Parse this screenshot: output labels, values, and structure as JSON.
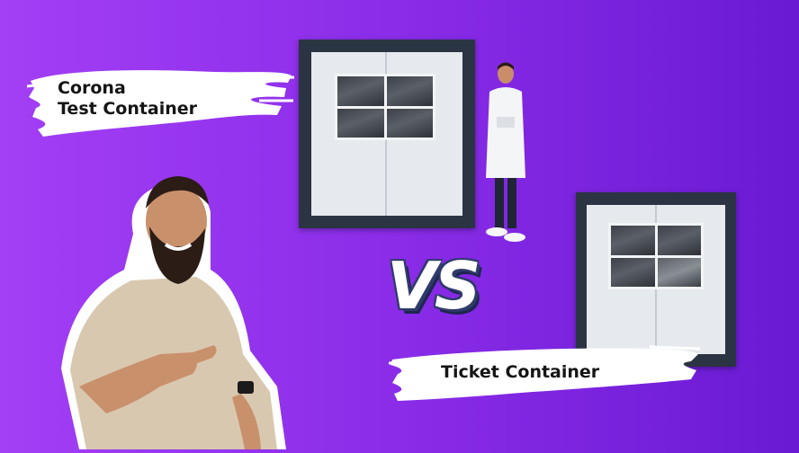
{
  "labels": {
    "left_line1": "Corona",
    "left_line2": "Test Container",
    "right": "Ticket Container"
  },
  "versus": "VS",
  "colors": {
    "background_left": "#a33ff5",
    "background_right": "#6a1ad3",
    "container_frame": "#2b3442",
    "container_panel": "#e6e9ee",
    "brush": "#ffffff",
    "vs_outline": "#2f3b6b"
  }
}
